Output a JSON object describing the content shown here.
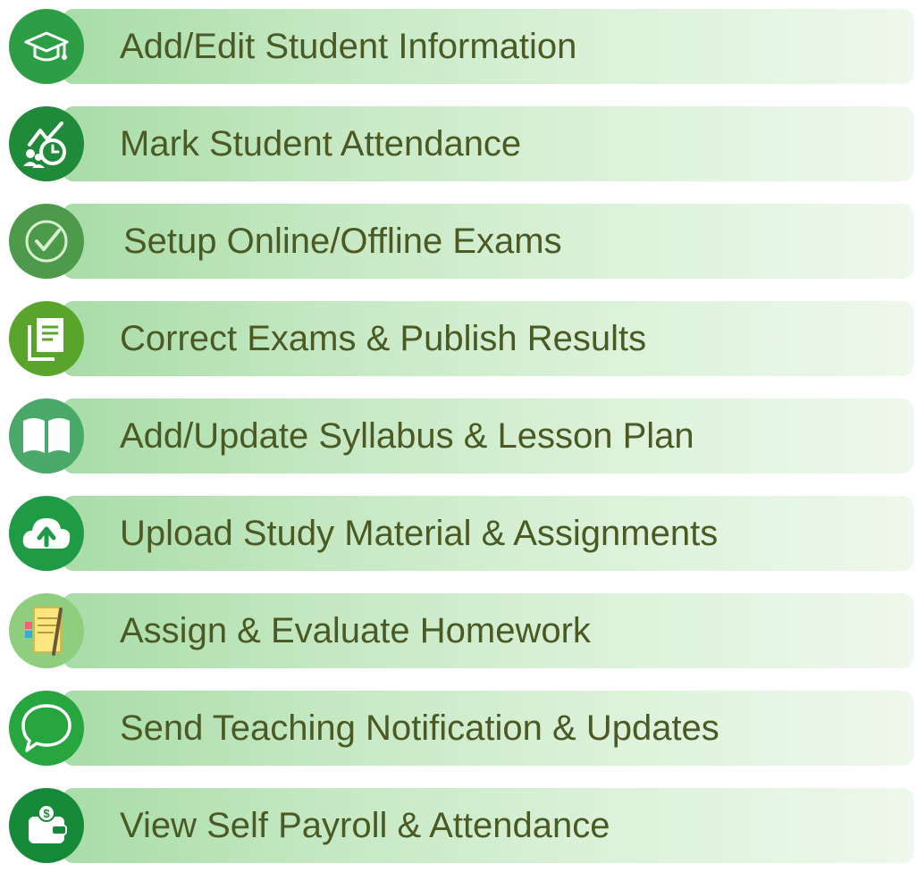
{
  "features": [
    {
      "label": "Add/Edit Student Information",
      "icon": "graduation-cap-icon",
      "icon_color": "#2e9e46"
    },
    {
      "label": "Mark Student Attendance",
      "icon": "attendance-clock-icon",
      "icon_color": "#1f8a3a"
    },
    {
      "label": "Setup Online/Offline Exams",
      "icon": "check-circle-icon",
      "icon_color": "#4d9a4a"
    },
    {
      "label": "Correct Exams & Publish Results",
      "icon": "documents-icon",
      "icon_color": "#59a52c"
    },
    {
      "label": "Add/Update Syllabus & Lesson Plan",
      "icon": "open-book-icon",
      "icon_color": "#49a86a"
    },
    {
      "label": "Upload Study Material & Assignments",
      "icon": "cloud-upload-icon",
      "icon_color": "#1f9a45"
    },
    {
      "label": "Assign & Evaluate Homework",
      "icon": "notepad-pencil-icon",
      "icon_color": "#8fce7e"
    },
    {
      "label": "Send Teaching Notification & Updates",
      "icon": "chat-bubble-icon",
      "icon_color": "#27a640"
    },
    {
      "label": "View Self Payroll & Attendance",
      "icon": "wallet-icon",
      "icon_color": "#178a3a"
    }
  ]
}
